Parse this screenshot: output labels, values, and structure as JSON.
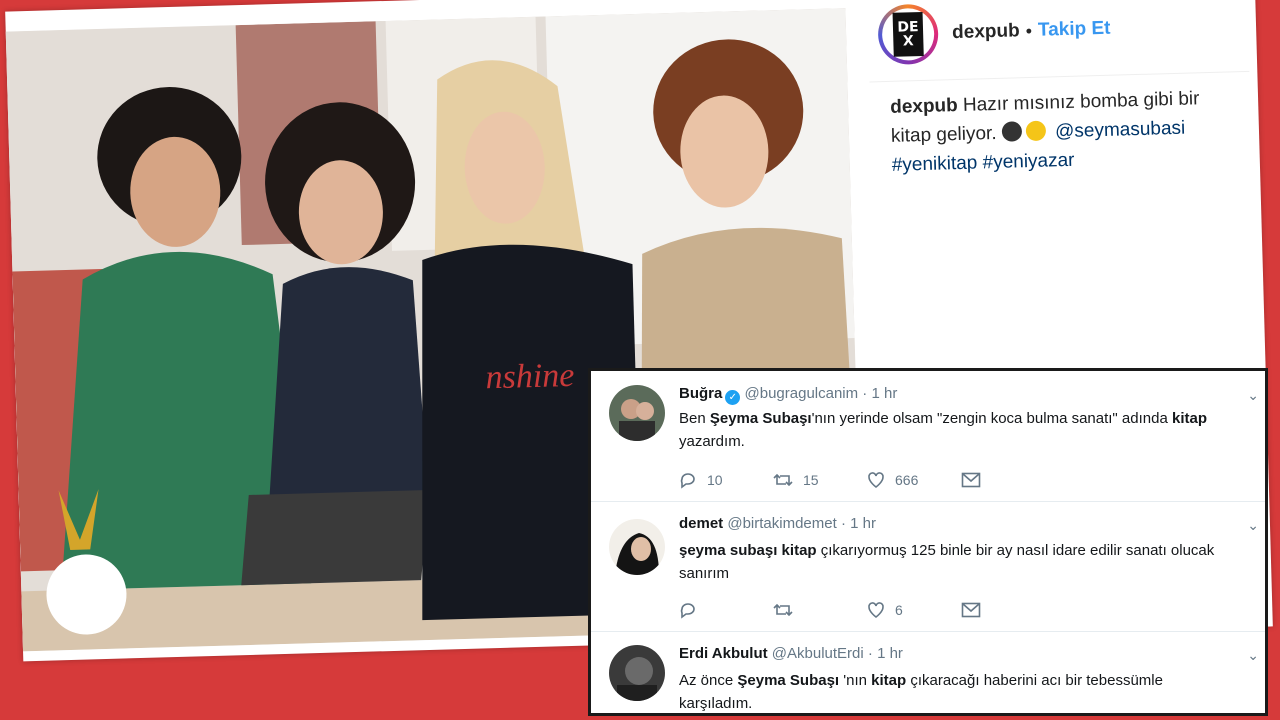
{
  "instagram": {
    "username": "dexpub",
    "separator": "•",
    "follow_label": "Takip Et",
    "logo_text_top": "DE",
    "logo_text_bottom": "X",
    "caption_user": "dexpub",
    "caption_text": "Hazır mısınız bomba gibi bir kitap geliyor.",
    "caption_mention": "@seymasubasi",
    "caption_hashtags": "#yenikitap #yeniyazar",
    "emojis": [
      "bomb-emoji",
      "sunglasses-emoji"
    ],
    "photo_shirt_text": "nshine"
  },
  "tweets": [
    {
      "name": "Buğra",
      "verified": true,
      "handle": "@bugragulcanim",
      "time": "1 hr",
      "text_before": "Ben ",
      "text_bold1": "Şeyma Subaşı",
      "text_mid": "'nın yerinde olsam \"zengin koca bulma sanatı\" adında ",
      "text_bold2": "kitap",
      "text_after": " yazardım.",
      "replies": "10",
      "retweets": "15",
      "likes": "666"
    },
    {
      "name": "demet",
      "handle": "@birtakimdemet",
      "time": "1 hr",
      "text_bold1": "şeyma subaşı kitap",
      "text_after": " çıkarıyormuş 125 binle bir ay nasıl idare edilir sanatı olucak sanırım",
      "replies": "",
      "retweets": "",
      "likes": "6"
    },
    {
      "name": "Erdi Akbulut",
      "handle": "@AkbulutErdi",
      "time": "1 hr",
      "text_before": "Az önce ",
      "text_bold1": "Şeyma Subaşı",
      "text_mid": " 'nın ",
      "text_bold2": "kitap",
      "text_after": " çıkaracağı haberini acı bir tebessümle karşıladım."
    }
  ],
  "colors": {
    "background_red": "#d63a3a",
    "instagram_blue": "#3897f0",
    "twitter_blue": "#1da1f2",
    "twitter_grey": "#657786"
  }
}
